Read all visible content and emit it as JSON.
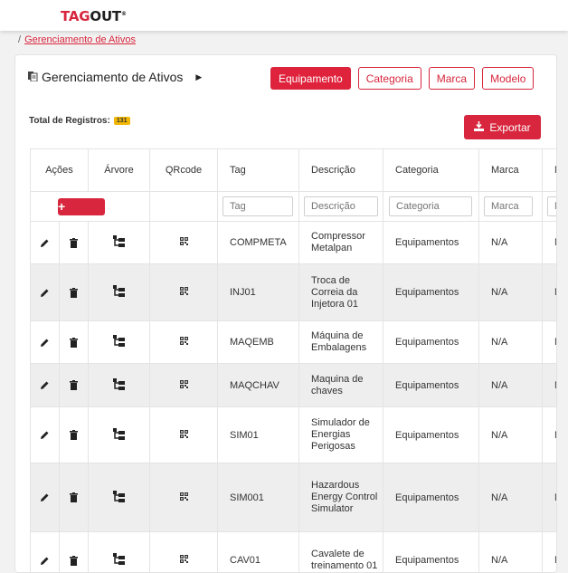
{
  "brand": {
    "tag": "TAG",
    "out": "OUT",
    "mark": "®"
  },
  "breadcrumb": {
    "separator": "/",
    "link": "Gerenciamento de Ativos"
  },
  "card": {
    "title": "Gerenciamento de Ativos"
  },
  "tabs": [
    {
      "label": "Equipamento",
      "active": true
    },
    {
      "label": "Categoria",
      "active": false
    },
    {
      "label": "Marca",
      "active": false
    },
    {
      "label": "Modelo",
      "active": false
    }
  ],
  "total": {
    "label": "Total de Registros:",
    "count": "131"
  },
  "export": {
    "label": "Exportar"
  },
  "columns": [
    "Ações",
    "Árvore",
    "QRcode",
    "Tag",
    "Descrição",
    "Categoria",
    "Marca",
    "M"
  ],
  "filters": {
    "add": "+",
    "tag": "Tag",
    "descricao": "Descrição",
    "categoria": "Categoria",
    "marca": "Marca",
    "modelo": "M"
  },
  "rows": [
    {
      "tag": "COMPMETA",
      "descricao": "Compressor Metalpan",
      "categoria": "Equipamentos",
      "marca": "N/A",
      "modelo": "N"
    },
    {
      "tag": "INJ01",
      "descricao": "Troca de Correia da Injetora 01",
      "categoria": "Equipamentos",
      "marca": "N/A",
      "modelo": "N"
    },
    {
      "tag": "MAQEMB",
      "descricao": "Máquina de Embalagens",
      "categoria": "Equipamentos",
      "marca": "N/A",
      "modelo": "N"
    },
    {
      "tag": "MAQCHAV",
      "descricao": "Maquina de chaves",
      "categoria": "Equipamentos",
      "marca": "N/A",
      "modelo": "N"
    },
    {
      "tag": "SIM01",
      "descricao": "Simulador de Energias Perigosas",
      "categoria": "Equipamentos",
      "marca": "N/A",
      "modelo": "N"
    },
    {
      "tag": "SIM001",
      "descricao": "Hazardous Energy Control Simulator",
      "categoria": "Equipamentos",
      "marca": "N/A",
      "modelo": "N"
    },
    {
      "tag": "CAV01",
      "descricao": "Cavalete de treinamento 01",
      "categoria": "Equipamentos",
      "marca": "N/A",
      "modelo": "N"
    }
  ],
  "colors": {
    "accent": "#d7263d",
    "badge": "#f2b705"
  },
  "icons": {
    "edit": "pencil-icon",
    "delete": "trash-icon",
    "tree": "tree-icon",
    "qr": "qrcode-icon",
    "export": "download-icon",
    "title": "document-icon"
  }
}
